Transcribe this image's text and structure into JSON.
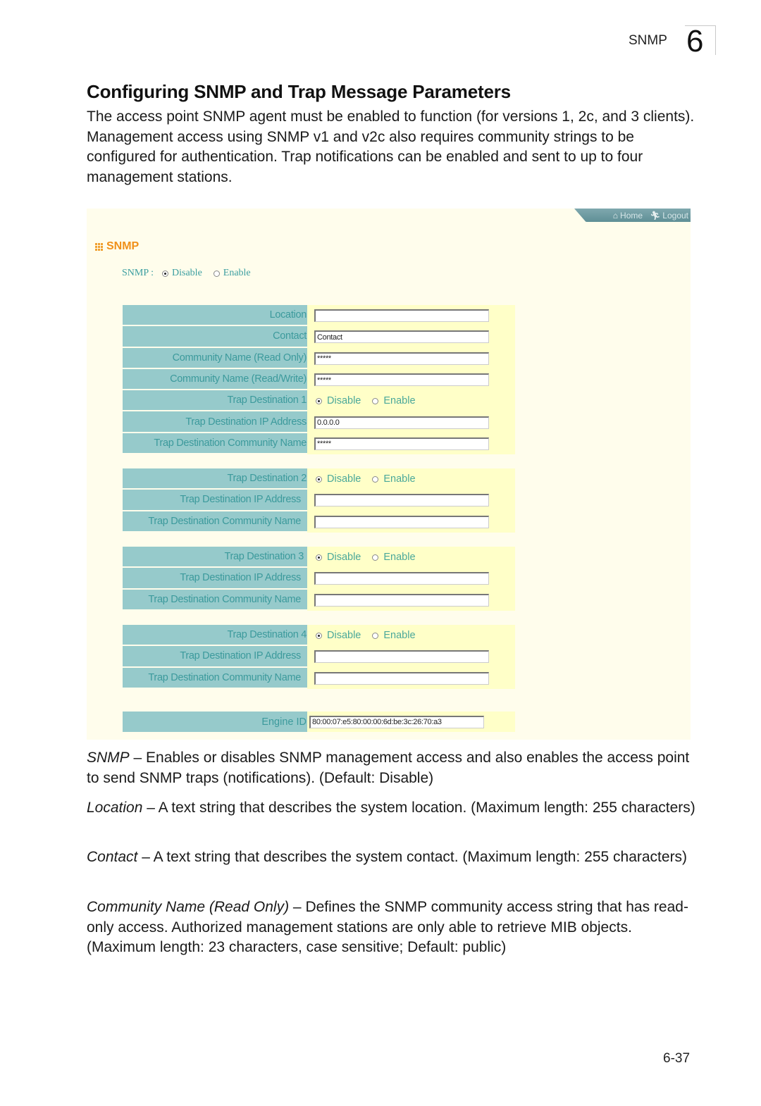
{
  "header": {
    "section": "SNMP",
    "chapter": "6"
  },
  "title": "Configuring SNMP and Trap Message Parameters",
  "intro": "The access point  SNMP agent must be enabled to function (for versions 1, 2c, and 3 clients). Management access using SNMP v1 and v2c also requires community strings to be configured for authentication. Trap notifications can be enabled and sent to up to four management stations.",
  "ui": {
    "nav": {
      "home": "Home",
      "logout": "Logout"
    },
    "panel_title": "SNMP",
    "snmp_label": "SNMP :",
    "snmp_state": "Disable",
    "radio_disable": "Disable",
    "radio_enable": "Enable",
    "fields": {
      "location": {
        "label": "Location",
        "value": ""
      },
      "contact": {
        "label": "Contact",
        "value": "Contact"
      },
      "community_ro": {
        "label": "Community Name (Read Only)",
        "value": "*****"
      },
      "community_rw": {
        "label": "Community Name (Read/Write)",
        "value": "*****"
      }
    },
    "traps": [
      {
        "label": "Trap Destination 1",
        "state": "Disable",
        "ip_label": "Trap Destination IP Address",
        "ip": "0.0.0.0",
        "comm_label": "Trap Destination Community Name",
        "comm": "*****"
      },
      {
        "label": "Trap Destination 2",
        "state": "Disable",
        "ip_label": "Trap Destination IP Address",
        "ip": "",
        "comm_label": "Trap Destination Community Name",
        "comm": ""
      },
      {
        "label": "Trap Destination 3",
        "state": "Disable",
        "ip_label": "Trap Destination IP Address",
        "ip": "",
        "comm_label": "Trap Destination Community Name",
        "comm": ""
      },
      {
        "label": "Trap Destination 4",
        "state": "Disable",
        "ip_label": "Trap Destination IP Address",
        "ip": "",
        "comm_label": "Trap Destination Community Name",
        "comm": ""
      }
    ],
    "engine": {
      "label": "Engine ID",
      "value": "80:00:07:e5:80:00:00:6d:be:3c:26:70:a3"
    }
  },
  "descriptions": [
    {
      "term": "SNMP",
      "text": " – Enables or disables SNMP management access and also enables the access point to send SNMP traps (notifications). (Default: Disable)"
    },
    {
      "term": "Location",
      "text": " – A text string that describes the system location. (Maximum length: 255 characters)"
    },
    {
      "term": "Contact",
      "text": " – A text string that describes the system contact. (Maximum length: 255 characters)"
    },
    {
      "term": "Community Name (Read Only)",
      "text": " – Defines the SNMP community access string that has read-only access. Authorized management stations are only able to retrieve MIB objects. (Maximum length: 23 characters, case sensitive; Default: public)"
    }
  ],
  "page_number": "6-37"
}
